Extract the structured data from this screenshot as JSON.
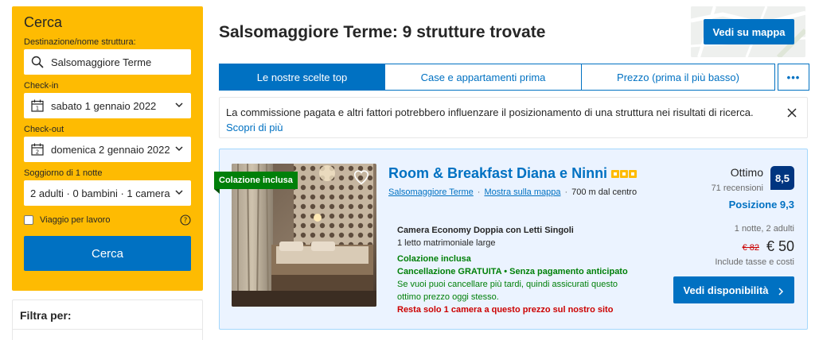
{
  "search": {
    "title": "Cerca",
    "destination_label": "Destinazione/nome struttura:",
    "destination_value": "Salsomaggiore Terme",
    "checkin_label": "Check-in",
    "checkin_value": "sabato 1 gennaio 2022",
    "checkin_icon_day": "1",
    "checkout_label": "Check-out",
    "checkout_value": "domenica 2 gennaio 2022",
    "checkout_icon_day": "2",
    "stay_label": "Soggiorno di 1 notte",
    "guests_value": "2 adulti · 0 bambini · 1 camera",
    "work_trip_label": "Viaggio per lavoro",
    "search_button": "Cerca"
  },
  "filters": {
    "title": "Filtra per:"
  },
  "header": {
    "title": "Salsomaggiore Terme: 9 strutture trovate",
    "map_button": "Vedi su mappa"
  },
  "sort_tabs": [
    {
      "label": "Le nostre scelte top",
      "active": true
    },
    {
      "label": "Case e appartamenti prima",
      "active": false
    },
    {
      "label": "Prezzo (prima il più basso)",
      "active": false
    }
  ],
  "more_tab": "•••",
  "notice": {
    "text": "La commissione pagata e altri fattori potrebbero influenzare il posizionamento di una struttura nei risultati di ricerca. ",
    "link": "Scopri di più"
  },
  "hotel": {
    "badge": "Colazione inclusa",
    "name": "Room & Breakfast Diana e Ninni",
    "stars": 3,
    "location": "Salsomaggiore Terme",
    "map_link": "Mostra sulla mappa",
    "distance": "700 m dal centro",
    "room_name": "Camera Economy Doppia con Letti Singoli",
    "bed": "1 letto matrimoniale large",
    "breakfast": "Colazione inclusa",
    "cancellation": "Cancellazione GRATUITA • Senza pagamento anticipato",
    "cancel_note_1": "Se vuoi puoi cancellare più tardi, quindi assicurati questo",
    "cancel_note_2": "ottimo prezzo oggi stesso.",
    "scarcity": "Resta solo 1 camera a questo prezzo sul nostro sito",
    "rating_word": "Ottimo",
    "reviews": "71 recensioni",
    "score": "8,5",
    "location_score": "Posizione 9,3",
    "nights": "1 notte, 2 adulti",
    "old_price": "€ 82",
    "price": "€ 50",
    "tax_note": "Include tasse e costi",
    "availability_button": "Vedi disponibilità"
  },
  "colors": {
    "brand_blue": "#0071c2",
    "search_yellow": "#febb02",
    "score_navy": "#003580",
    "success_green": "#008009",
    "alert_red": "#cc0000"
  },
  "icons": [
    "search-icon",
    "calendar-icon",
    "chevron-down-icon",
    "help-icon",
    "close-icon",
    "heart-icon",
    "star-icon",
    "chevron-right-icon"
  ]
}
